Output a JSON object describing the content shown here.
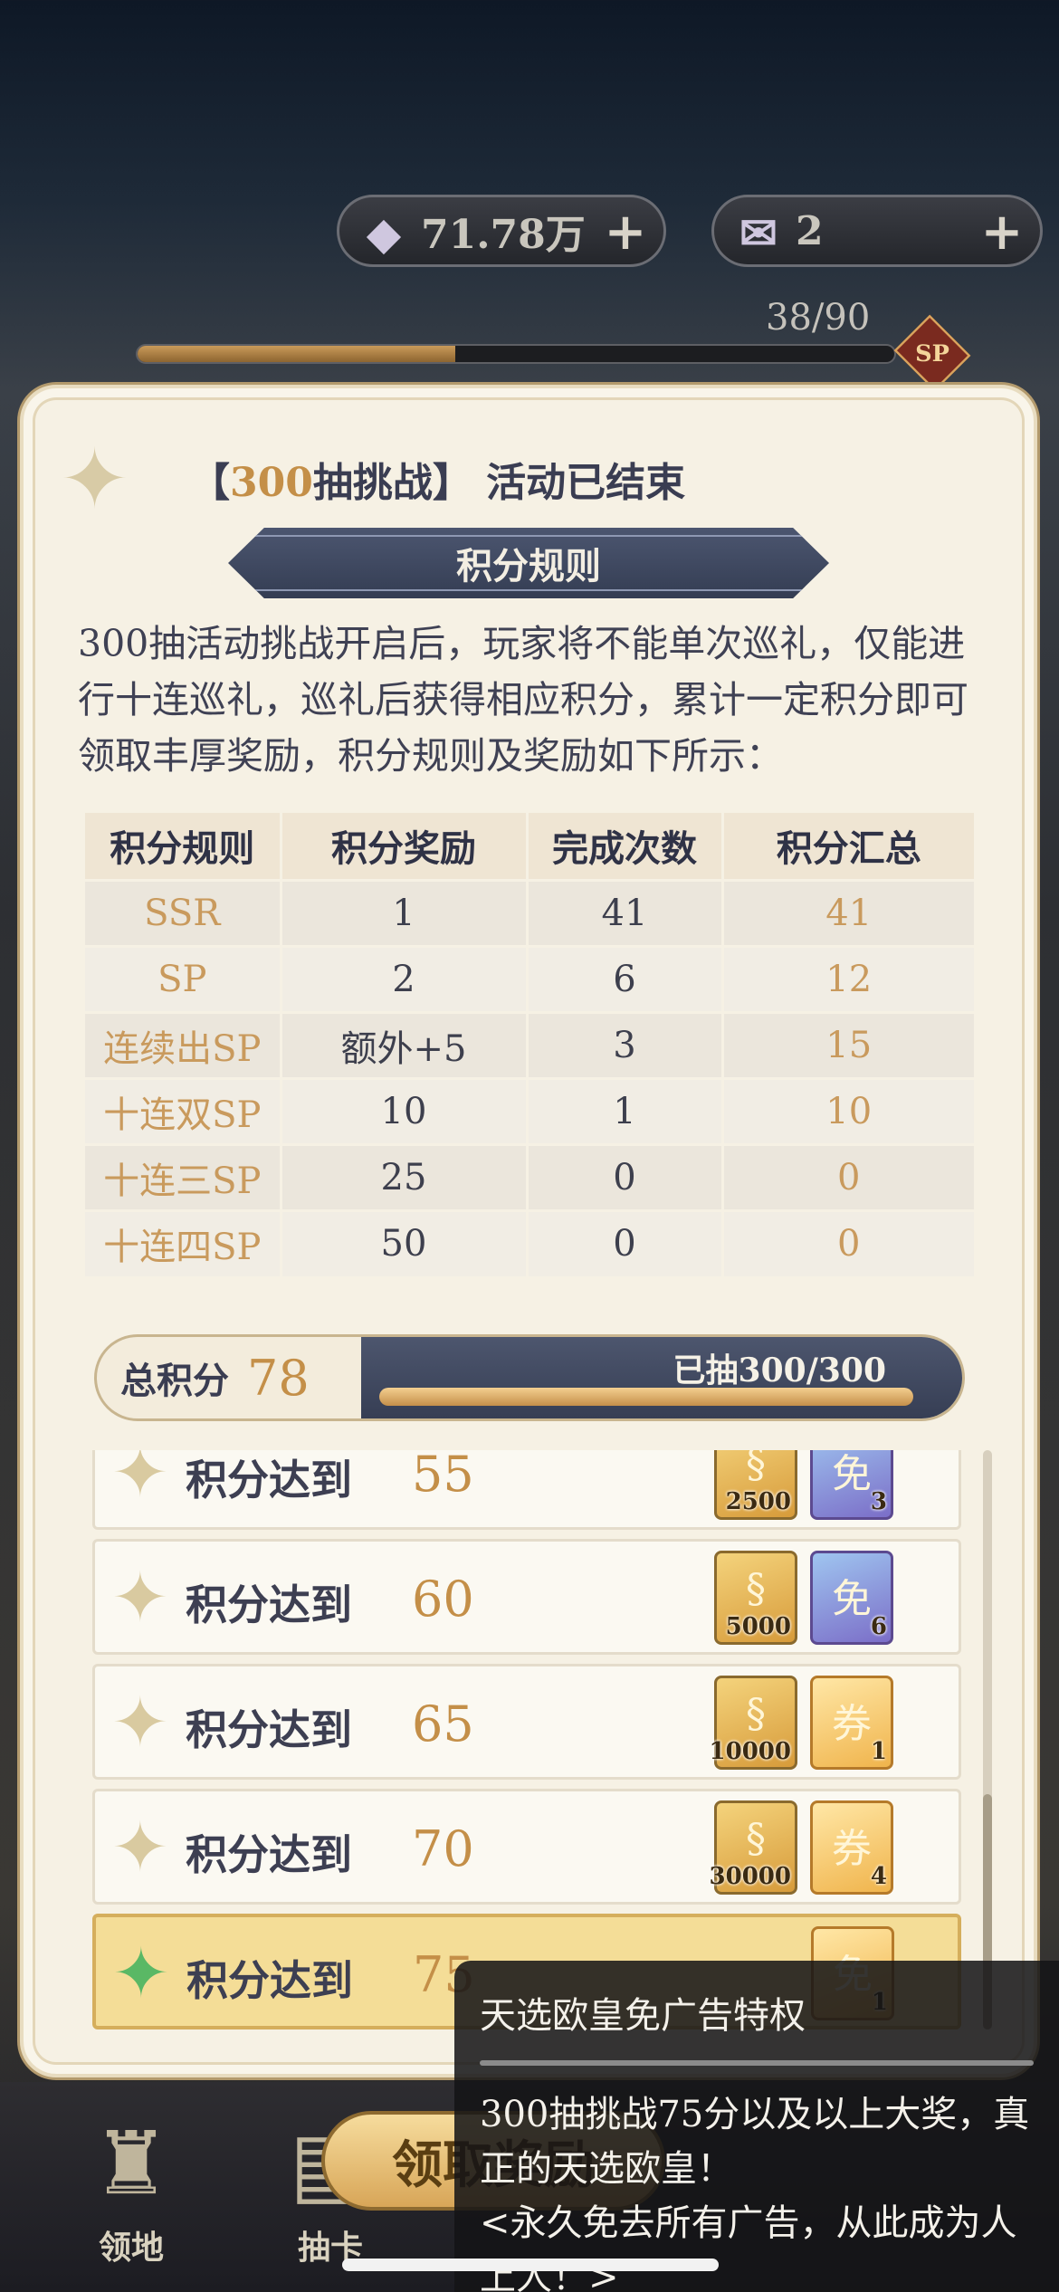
{
  "currencies": {
    "jade": {
      "icon": "crystal-icon",
      "value": "71.78万"
    },
    "tickets": {
      "icon": "scroll-icon",
      "value": "2"
    }
  },
  "top_progress": {
    "label": "38/90",
    "fraction": 0.42,
    "badge": "SP"
  },
  "panel": {
    "title_bracket_open": "【",
    "title_num": "300",
    "title_rest": "抽挑战】 活动已结束",
    "rules_banner": "积分规则",
    "rules_text": "300抽活动挑战开启后，玩家将不能单次巡礼，仅能进行十连巡礼，巡礼后获得相应积分，累计一定积分即可领取丰厚奖励，积分规则及奖励如下所示："
  },
  "table": {
    "headers": [
      "积分规则",
      "积分奖励",
      "完成次数",
      "积分汇总"
    ],
    "rows": [
      [
        "SSR",
        "1",
        "41",
        "41"
      ],
      [
        "SP",
        "2",
        "6",
        "12"
      ],
      [
        "连续出SP",
        "额外+5",
        "3",
        "15"
      ],
      [
        "十连双SP",
        "10",
        "1",
        "10"
      ],
      [
        "十连三SP",
        "25",
        "0",
        "0"
      ],
      [
        "十连四SP",
        "50",
        "0",
        "0"
      ]
    ]
  },
  "total": {
    "label": "总积分",
    "value": "78",
    "drawn": "已抽300/300",
    "fraction": 1.0
  },
  "rewards": [
    {
      "label": "积分达到",
      "value": "55",
      "items": [
        {
          "count": "2500"
        },
        {
          "count": "3"
        }
      ]
    },
    {
      "label": "积分达到",
      "value": "60",
      "items": [
        {
          "count": "5000"
        },
        {
          "count": "6"
        }
      ]
    },
    {
      "label": "积分达到",
      "value": "65",
      "items": [
        {
          "count": "10000"
        },
        {
          "count": "1"
        }
      ]
    },
    {
      "label": "积分达到",
      "value": "70",
      "items": [
        {
          "count": "30000"
        },
        {
          "count": "4"
        }
      ]
    },
    {
      "label": "积分达到",
      "value": "75",
      "items": [
        {
          "count": "1"
        }
      ]
    }
  ],
  "bottom_nav": {
    "items": [
      "领地",
      "抽卡",
      "",
      "",
      ""
    ],
    "claim_label": "领取奖励"
  },
  "tooltip": {
    "title": "天选欧皇免广告特权",
    "line1": "300抽挑战75分以及以上大奖，真正的天选欧皇！",
    "line2": "<永久免去所有广告，从此成为人上人！>"
  }
}
